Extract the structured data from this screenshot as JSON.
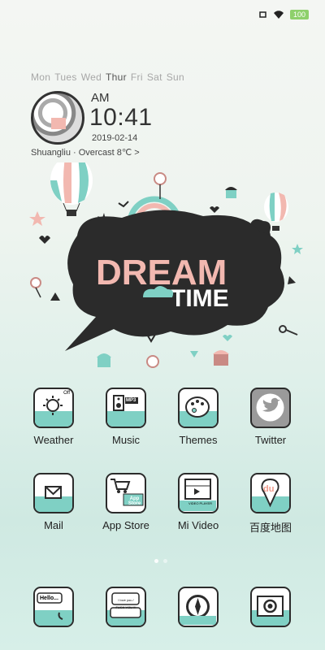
{
  "status_bar": {
    "battery": "100"
  },
  "days": [
    "Mon",
    "Tues",
    "Wed",
    "Thur",
    "Fri",
    "Sat",
    "Sun"
  ],
  "active_day": "Thur",
  "clock": {
    "ampm": "AM",
    "time": "10:41",
    "date": "2019-02-14"
  },
  "weather": {
    "line": "Shuangliu · Overcast 8℃  >"
  },
  "wallpaper": {
    "title_line1": "DREAM",
    "title_line2": "TIME"
  },
  "apps_row1": [
    {
      "label": "Weather",
      "icon": "weather-icon"
    },
    {
      "label": "Music",
      "icon": "music-icon"
    },
    {
      "label": "Themes",
      "icon": "themes-icon"
    },
    {
      "label": "Twitter",
      "icon": "twitter-icon"
    }
  ],
  "apps_row2": [
    {
      "label": "Mail",
      "icon": "mail-icon"
    },
    {
      "label": "App Store",
      "icon": "app-store-icon"
    },
    {
      "label": "Mi Video",
      "icon": "video-icon"
    },
    {
      "label": "百度地图",
      "icon": "baidu-maps-icon"
    }
  ],
  "dock": [
    {
      "icon": "phone-icon",
      "text": "Hello..."
    },
    {
      "icon": "messages-icon",
      "text": "I love you / FUCK YOU !!!"
    },
    {
      "icon": "browser-icon"
    },
    {
      "icon": "camera-icon"
    }
  ],
  "icon_labels": {
    "music": "MP3",
    "appstore": "App Store",
    "weather": "Off",
    "baidu": "du",
    "video": "VIDEO PLAYER"
  },
  "colors": {
    "mint": "#7fd0c4",
    "pink": "#f2b8b0",
    "dark": "#2b2b2b"
  }
}
